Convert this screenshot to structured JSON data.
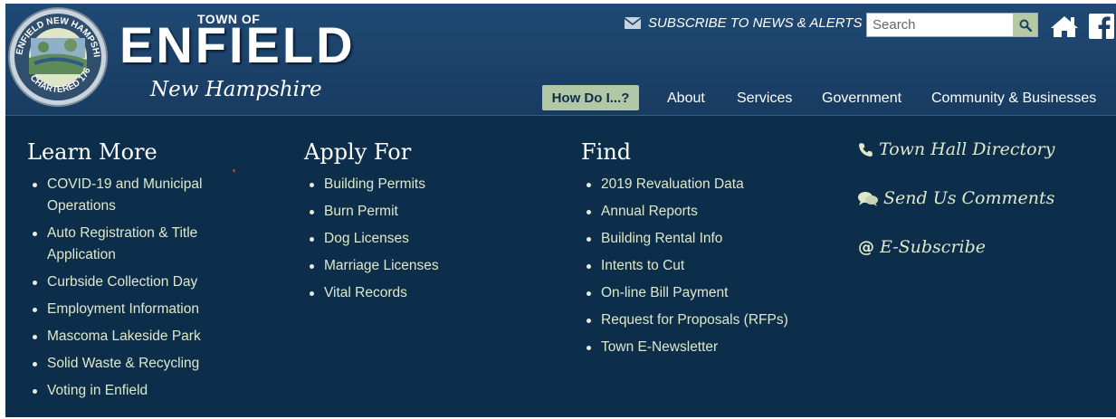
{
  "header": {
    "town_of": "TOWN OF",
    "town_name": "ENFIELD",
    "state": "New Hampshire",
    "seal": {
      "top_text": "ENFIELD NEW HAMPSHIRE",
      "bottom_text": "CHARTERED 1761"
    }
  },
  "utility": {
    "subscribe_label": "SUBSCRIBE TO NEWS & ALERTS",
    "search_placeholder": "Search",
    "search_value": ""
  },
  "nav": {
    "how_do_i": "How Do I...?",
    "items": [
      "About",
      "Services",
      "Government",
      "Community & Businesses"
    ]
  },
  "columns": {
    "learn_more": {
      "title": "Learn More",
      "items": [
        "COVID-19 and Municipal Operations",
        "Auto Registration & Title Application",
        "Curbside Collection Day",
        "Employment Information",
        "Mascoma Lakeside Park",
        "Solid Waste & Recycling",
        "Voting in Enfield"
      ]
    },
    "apply_for": {
      "title": "Apply For",
      "items": [
        "Building Permits",
        "Burn Permit",
        "Dog Licenses",
        "Marriage Licenses",
        "Vital Records"
      ]
    },
    "find": {
      "title": "Find",
      "items": [
        "2019 Revaluation Data",
        "Annual Reports",
        "Building Rental Info",
        "Intents to Cut",
        "On-line Bill Payment",
        "Request for Proposals (RFPs)",
        "Town E-Newsletter"
      ]
    }
  },
  "quick_links": [
    {
      "label": "Town Hall Directory",
      "icon": "phone-icon"
    },
    {
      "label": "Send Us Comments",
      "icon": "comments-icon"
    },
    {
      "label": "E-Subscribe",
      "icon": "at-icon"
    }
  ],
  "colors": {
    "header_bg": "#1b4169",
    "body_bg": "#0c2e4b",
    "accent_green": "#b2c7a5",
    "link_text": "#dfe8c9"
  }
}
